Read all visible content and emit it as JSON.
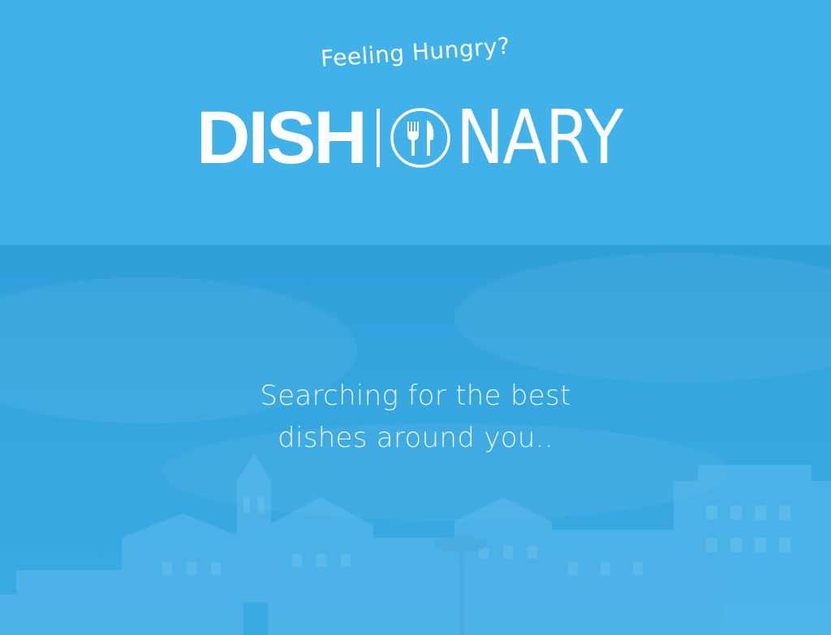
{
  "header": {
    "tagline": "Feeling Hungry?",
    "logo": {
      "bold_part": "DISH",
      "light_part": "NARY",
      "plate_icon": "fork-knife-plate-icon"
    }
  },
  "hero": {
    "message_line1": "Searching for the best",
    "message_line2": "dishes around you.."
  },
  "colors": {
    "header_bg": "#41b1ea",
    "hero_bg": "#35a6e0",
    "text": "#ffffff"
  }
}
